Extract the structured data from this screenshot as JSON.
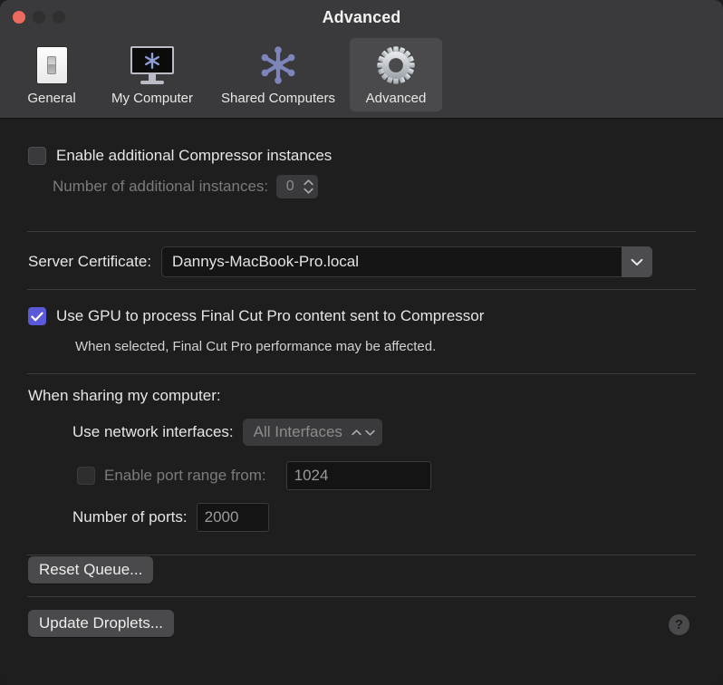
{
  "window": {
    "title": "Advanced",
    "traffic_lights": [
      "close-button",
      "minimize-button",
      "maximize-button"
    ]
  },
  "toolbar": {
    "tabs": [
      {
        "label": "General",
        "icon": "light-switch-icon",
        "selected": false
      },
      {
        "label": "My Computer",
        "icon": "display-asterisk-icon",
        "selected": false
      },
      {
        "label": "Shared Computers",
        "icon": "network-nodes-icon",
        "selected": false
      },
      {
        "label": "Advanced",
        "icon": "gear-icon",
        "selected": true
      }
    ]
  },
  "settings": {
    "enable_instances": {
      "label": "Enable additional Compressor instances",
      "checked": false
    },
    "num_instances": {
      "label": "Number of additional instances:",
      "value": "0",
      "enabled": false
    },
    "server_certificate": {
      "label": "Server Certificate:",
      "value": "Dannys-MacBook-Pro.local"
    },
    "use_gpu": {
      "label": "Use GPU to process Final Cut Pro content sent to Compressor",
      "checked": true,
      "note": "When selected, Final Cut Pro performance may be affected."
    },
    "sharing": {
      "heading": "When sharing my computer:",
      "network_interfaces": {
        "label": "Use network interfaces:",
        "value": "All Interfaces",
        "enabled": false
      },
      "port_range": {
        "label": "Enable port range from:",
        "checked": false,
        "enabled": false,
        "value": "1024"
      },
      "num_ports": {
        "label": "Number of ports:",
        "value": "2000"
      }
    },
    "reset_queue_button": "Reset Queue...",
    "update_droplets_button": "Update Droplets...",
    "help_button": "?"
  },
  "colors": {
    "accent": "#5a59d8",
    "toolbar_bg": "#3a3a3c",
    "content_bg": "#1e1e1e",
    "close_light": "#ec6a5e"
  }
}
